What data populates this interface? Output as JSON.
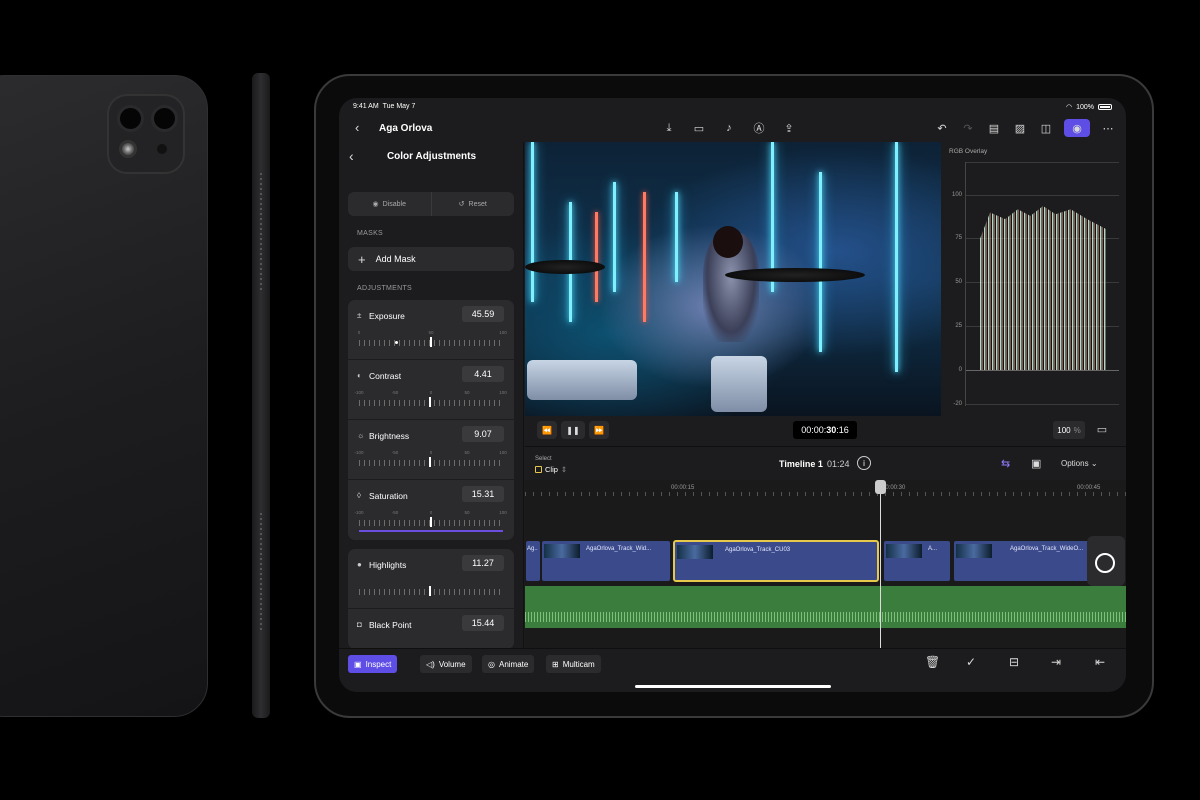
{
  "status": {
    "time": "9:41 AM",
    "date": "Tue May 7",
    "battery": "100%"
  },
  "project": {
    "title": "Aga Orlova"
  },
  "top_icons": [
    "import-icon",
    "camera-icon",
    "mic-icon",
    "pen-icon",
    "share-icon",
    "undo-icon",
    "redo-icon",
    "browser-icon",
    "photos-icon",
    "effects-icon",
    "inspector-icon",
    "more-icon"
  ],
  "sidebar": {
    "title": "Color Adjustments",
    "disable_label": "Disable",
    "reset_label": "Reset",
    "masks_label": "MASKS",
    "add_mask_label": "Add Mask",
    "adjustments_label": "ADJUSTMENTS",
    "group1": [
      {
        "icon": "±",
        "name": "Exposure",
        "value": "45.59",
        "scale": [
          "0",
          "",
          "50",
          "100"
        ]
      },
      {
        "icon": "◐",
        "name": "Contrast",
        "value": "4.41",
        "scale": [
          "-100",
          "-50",
          "0",
          "50",
          "100"
        ]
      },
      {
        "icon": "☼",
        "name": "Brightness",
        "value": "9.07",
        "scale": [
          "-100",
          "-50",
          "0",
          "50",
          "100"
        ]
      },
      {
        "icon": "◊",
        "name": "Saturation",
        "value": "15.31",
        "scale": [
          "-100",
          "-50",
          "0",
          "50",
          "100"
        ]
      }
    ],
    "group2": [
      {
        "icon": "●",
        "name": "Highlights",
        "value": "11.27"
      },
      {
        "icon": "◘",
        "name": "Black Point",
        "value": "15.44"
      }
    ]
  },
  "transport": {
    "timecode_prefix": "00:00:",
    "timecode_main": "30",
    "timecode_suffix": ":16",
    "zoom": "100",
    "zoom_unit": "%"
  },
  "scope": {
    "title": "RGB Overlay",
    "ticks": [
      "100",
      "75",
      "50",
      "25",
      "0",
      "-20"
    ]
  },
  "timeline": {
    "select_label": "Select",
    "mode_label": "Clip",
    "title": "Timeline 1",
    "duration": "01:24",
    "options_label": "Options",
    "ruler": [
      "00:00:15",
      "00:00:30",
      "00:00:45"
    ],
    "clips": [
      "Ag..",
      "AgaOrlova_Track_Wid...",
      "AgaOrlova_Track_CU03",
      "A...",
      "AgaOrlova_Track_WideO..."
    ]
  },
  "bottom": {
    "inspect": "Inspect",
    "volume": "Volume",
    "animate": "Animate",
    "multicam": "Multicam"
  }
}
